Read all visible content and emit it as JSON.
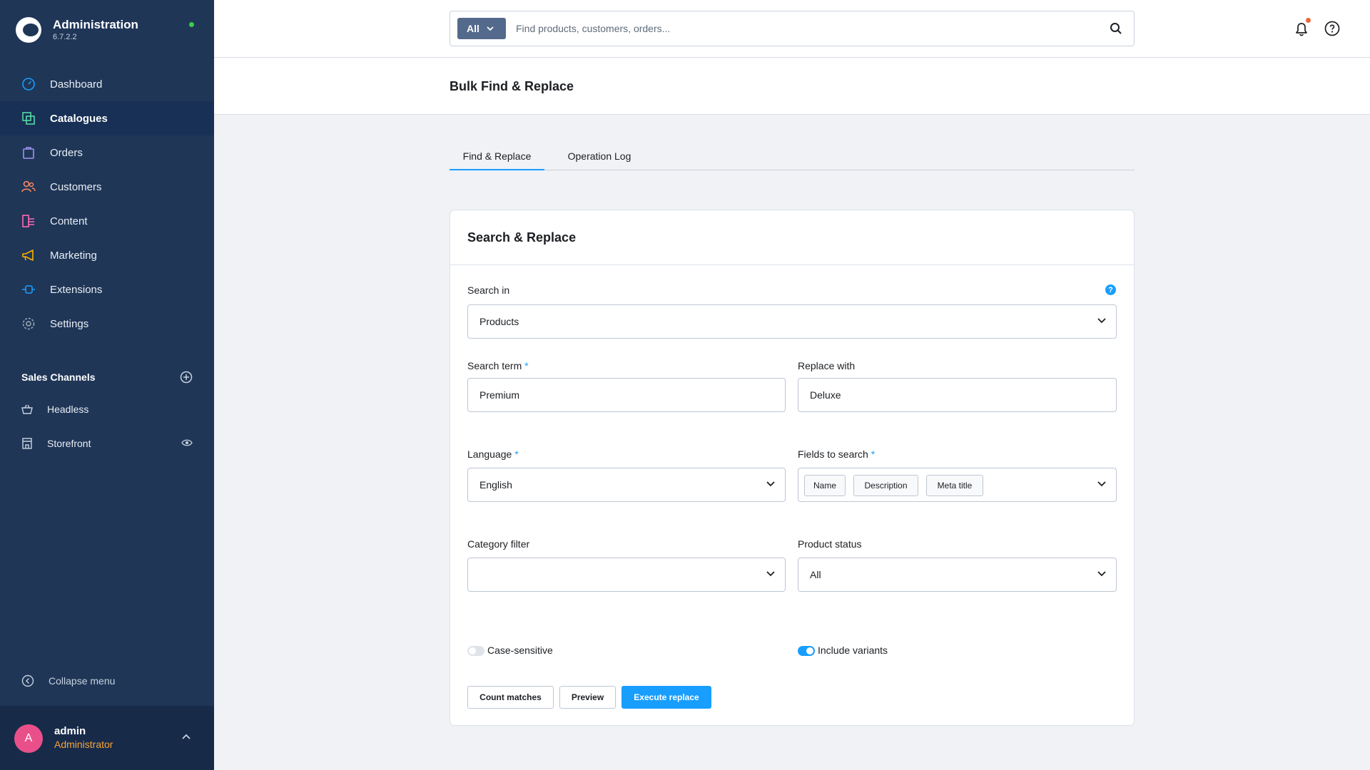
{
  "app": {
    "title": "Administration",
    "version": "6.7.2.2"
  },
  "sidebar": {
    "items": [
      {
        "label": "Dashboard",
        "icon": "gauge-icon",
        "color": "#189eff"
      },
      {
        "label": "Catalogues",
        "icon": "catalogue-icon",
        "color": "#57d9a3"
      },
      {
        "label": "Orders",
        "icon": "shopping-bag-icon",
        "color": "#a092f0"
      },
      {
        "label": "Customers",
        "icon": "users-icon",
        "color": "#f88962"
      },
      {
        "label": "Content",
        "icon": "content-list-icon",
        "color": "#ff68b4"
      },
      {
        "label": "Marketing",
        "icon": "megaphone-icon",
        "color": "#ffd700"
      },
      {
        "label": "Extensions",
        "icon": "plug-icon",
        "color": "#189eff"
      },
      {
        "label": "Settings",
        "icon": "gear-icon",
        "color": "#9aa8b5"
      }
    ],
    "active": "Catalogues",
    "sales_channels": {
      "title": "Sales Channels",
      "items": [
        {
          "label": "Headless",
          "icon": "basket-icon"
        },
        {
          "label": "Storefront",
          "icon": "storefront-icon"
        }
      ]
    },
    "collapse_label": "Collapse menu"
  },
  "user": {
    "initial": "A",
    "name": "admin",
    "role": "Administrator"
  },
  "search": {
    "type": "All",
    "placeholder": "Find products, customers, orders..."
  },
  "page": {
    "title": "Bulk Find & Replace"
  },
  "tabs": [
    {
      "label": "Find & Replace",
      "active": true
    },
    {
      "label": "Operation Log",
      "active": false
    }
  ],
  "form": {
    "card_title": "Search & Replace",
    "search_in": {
      "label": "Search in",
      "value": "Products"
    },
    "search_term": {
      "label": "Search term",
      "value": "Premium"
    },
    "replace_with": {
      "label": "Replace with",
      "value": "Deluxe"
    },
    "language": {
      "label": "Language",
      "value": "English"
    },
    "fields_to_search": {
      "label": "Fields to search",
      "values": [
        "Name",
        "Description",
        "Meta title"
      ]
    },
    "category_filter": {
      "label": "Category filter",
      "value": ""
    },
    "product_status": {
      "label": "Product status",
      "value": "All"
    },
    "case_sensitive": {
      "label": "Case-sensitive",
      "checked": false
    },
    "include_variants": {
      "label": "Include variants",
      "checked": true
    },
    "buttons": {
      "count": "Count matches",
      "preview": "Preview",
      "execute": "Execute replace"
    }
  },
  "colors": {
    "sidebar": "#1f3657",
    "accent": "#189eff",
    "required": "#189eff"
  }
}
